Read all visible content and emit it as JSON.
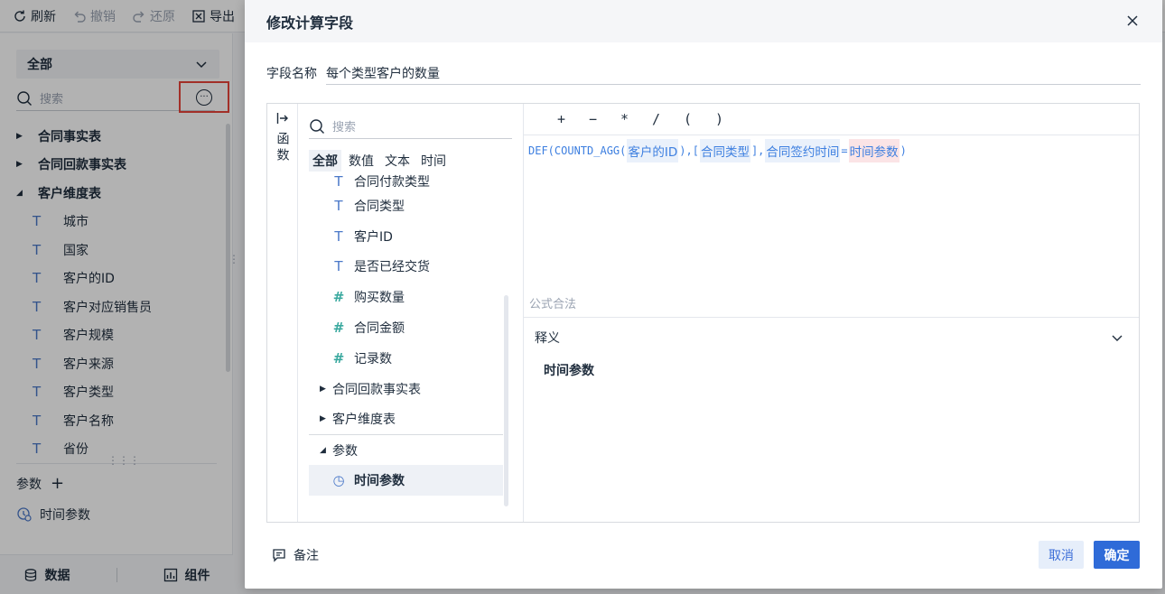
{
  "toolbar": {
    "refresh": "刷新",
    "undo": "撤销",
    "redo": "还原",
    "export": "导出"
  },
  "left_panel": {
    "scope": "全部",
    "search_placeholder": "搜索",
    "tree": [
      {
        "label": "合同事实表",
        "type": "group",
        "expanded": false
      },
      {
        "label": "合同回款事实表",
        "type": "group",
        "expanded": false
      },
      {
        "label": "客户维度表",
        "type": "group",
        "expanded": true
      },
      {
        "label": "城市",
        "type": "text"
      },
      {
        "label": "国家",
        "type": "text"
      },
      {
        "label": "客户的ID",
        "type": "text"
      },
      {
        "label": "客户对应销售员",
        "type": "text"
      },
      {
        "label": "客户规模",
        "type": "text"
      },
      {
        "label": "客户来源",
        "type": "text"
      },
      {
        "label": "客户类型",
        "type": "text"
      },
      {
        "label": "客户名称",
        "type": "text"
      },
      {
        "label": "省份",
        "type": "text"
      }
    ],
    "params_label": "参数",
    "params": [
      "时间参数"
    ],
    "bottom_tabs": [
      "数据",
      "组件"
    ]
  },
  "dialog": {
    "title": "修改计算字段",
    "field_name_label": "字段名称",
    "field_name_value": "每个类型客户的数量",
    "function_rail_label": "函数",
    "fields_search_placeholder": "搜索",
    "field_tabs": [
      "全部",
      "数值",
      "文本",
      "时间"
    ],
    "field_list": [
      {
        "label": "合同付款类型",
        "kind": "text",
        "cut": true
      },
      {
        "label": "合同类型",
        "kind": "text"
      },
      {
        "label": "客户ID",
        "kind": "text"
      },
      {
        "label": "是否已经交货",
        "kind": "text"
      },
      {
        "label": "购买数量",
        "kind": "number"
      },
      {
        "label": "合同金额",
        "kind": "number"
      },
      {
        "label": "记录数",
        "kind": "number"
      },
      {
        "label": "合同回款事实表",
        "kind": "group"
      },
      {
        "label": "客户维度表",
        "kind": "group"
      },
      {
        "label": "参数",
        "kind": "group-open"
      },
      {
        "label": "时间参数",
        "kind": "param",
        "selected": true
      }
    ],
    "operators": [
      "+",
      "−",
      "*",
      "/",
      "(",
      ")"
    ],
    "formula": {
      "fn": "DEF(COUNTD_AGG(",
      "t1": "客户的ID",
      "p1": "),[",
      "t2": "合同类型",
      "p2": "],",
      "t3": "合同签约时间",
      "p3": "=",
      "t4": "时间参数",
      "p4": ")"
    },
    "validity": "公式合法",
    "explain_label": "释义",
    "explain_text": "时间参数",
    "note_label": "备注",
    "cancel_label": "取消",
    "ok_label": "确定"
  },
  "colors": {
    "accent": "#2f6bd8",
    "highlight_border": "#e8443a",
    "token_bg": "#eaf1fb",
    "param_token_bg": "#fbe4e6"
  }
}
